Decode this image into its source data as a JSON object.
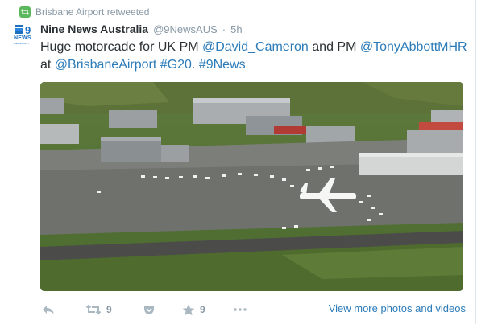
{
  "retweet_context": {
    "text": "Brisbane Airport retweeted",
    "icon": "retweet-icon",
    "color": "#5cb85c"
  },
  "author": {
    "name": "Nine News Australia",
    "handle": "@9NewsAUS",
    "separator": "·",
    "time": "5h"
  },
  "avatar": {
    "logo_text": "NEWS",
    "tagline": "WE'RE FIRST",
    "icon": "nine-news-logo"
  },
  "tweet": {
    "prefix": "Huge motorcade for UK PM ",
    "mention1": "@David_Cameron",
    "middle": " and PM ",
    "mention2": "@TonyAbbottMHR",
    "at_word": "at ",
    "mention3": "@BrisbaneAirport",
    "space": " ",
    "hashtag1": "#G20",
    "period": ". ",
    "hashtag2": "#9News"
  },
  "media": {
    "icon": "aerial-airport-photo"
  },
  "actions": {
    "reply_icon": "reply-icon",
    "retweet_icon": "retweet-icon",
    "retweet_count": "9",
    "pocket_icon": "pocket-icon",
    "favorite_icon": "star-icon",
    "favorite_count": "9",
    "more_icon": "more-icon",
    "more_link": "View more photos and videos"
  },
  "colors": {
    "link": "#2b7bb9",
    "muted": "#8899a6",
    "text": "#292f33",
    "retweet_green": "#5cb85c"
  }
}
